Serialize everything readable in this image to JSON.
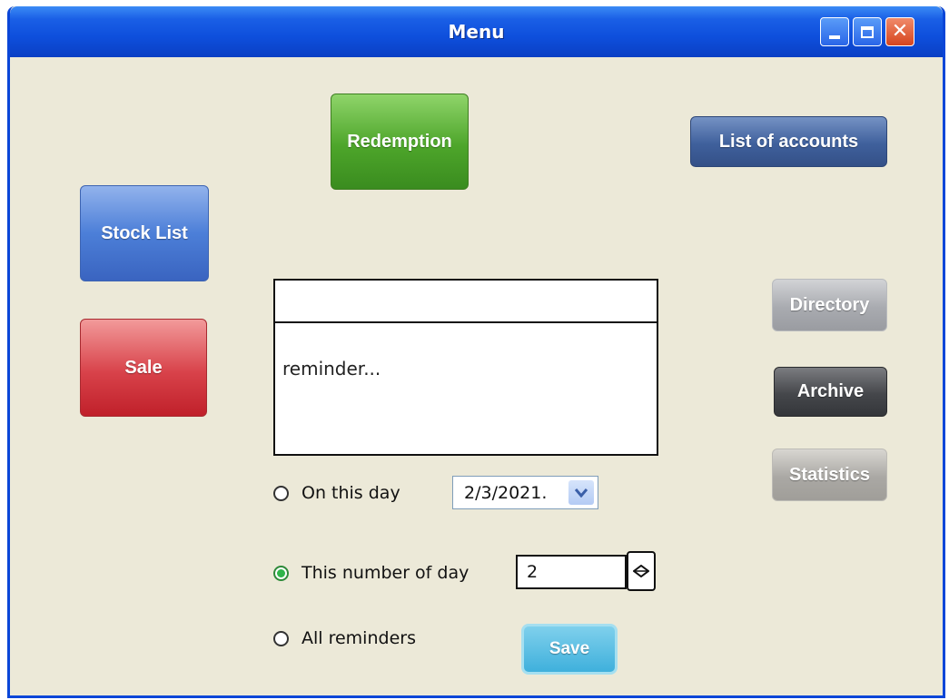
{
  "window": {
    "title": "Menu",
    "controls": {
      "minimize": "minimize-icon",
      "maximize": "maximize-icon",
      "close": "close-icon",
      "close_glyph": "✕"
    }
  },
  "buttons": {
    "redemption": "Redemption",
    "stock_list": "Stock List",
    "sale": "Sale",
    "list_of_accounts": "List of accounts",
    "directory": "Directory",
    "archive": "Archive",
    "statistics": "Statistics",
    "save": "Save"
  },
  "reminder": {
    "header_text": "",
    "body_text": "reminder..."
  },
  "options": {
    "on_this_day": {
      "label": "On this day",
      "checked": false
    },
    "this_number_of_day": {
      "label": "This number of day",
      "checked": true
    },
    "all_reminders": {
      "label": "All reminders",
      "checked": false
    }
  },
  "date_select": {
    "value": "2/3/2021.",
    "icon": "chevron-down-icon"
  },
  "day_number": {
    "value": "2",
    "icon": "stepper-icon"
  },
  "colors": {
    "title_bar": "#0e4fdc",
    "window_bg": "#ece9d8",
    "redemption": "#4da52a",
    "stock_list": "#4c7fd8",
    "sale": "#d8424a",
    "list_of_accounts": "#3f609c",
    "directory": "#a9abb0",
    "archive": "#45474b",
    "statistics": "#aaa8a4",
    "save": "#3fb0dc",
    "radio_selected": "#2fb44a"
  }
}
